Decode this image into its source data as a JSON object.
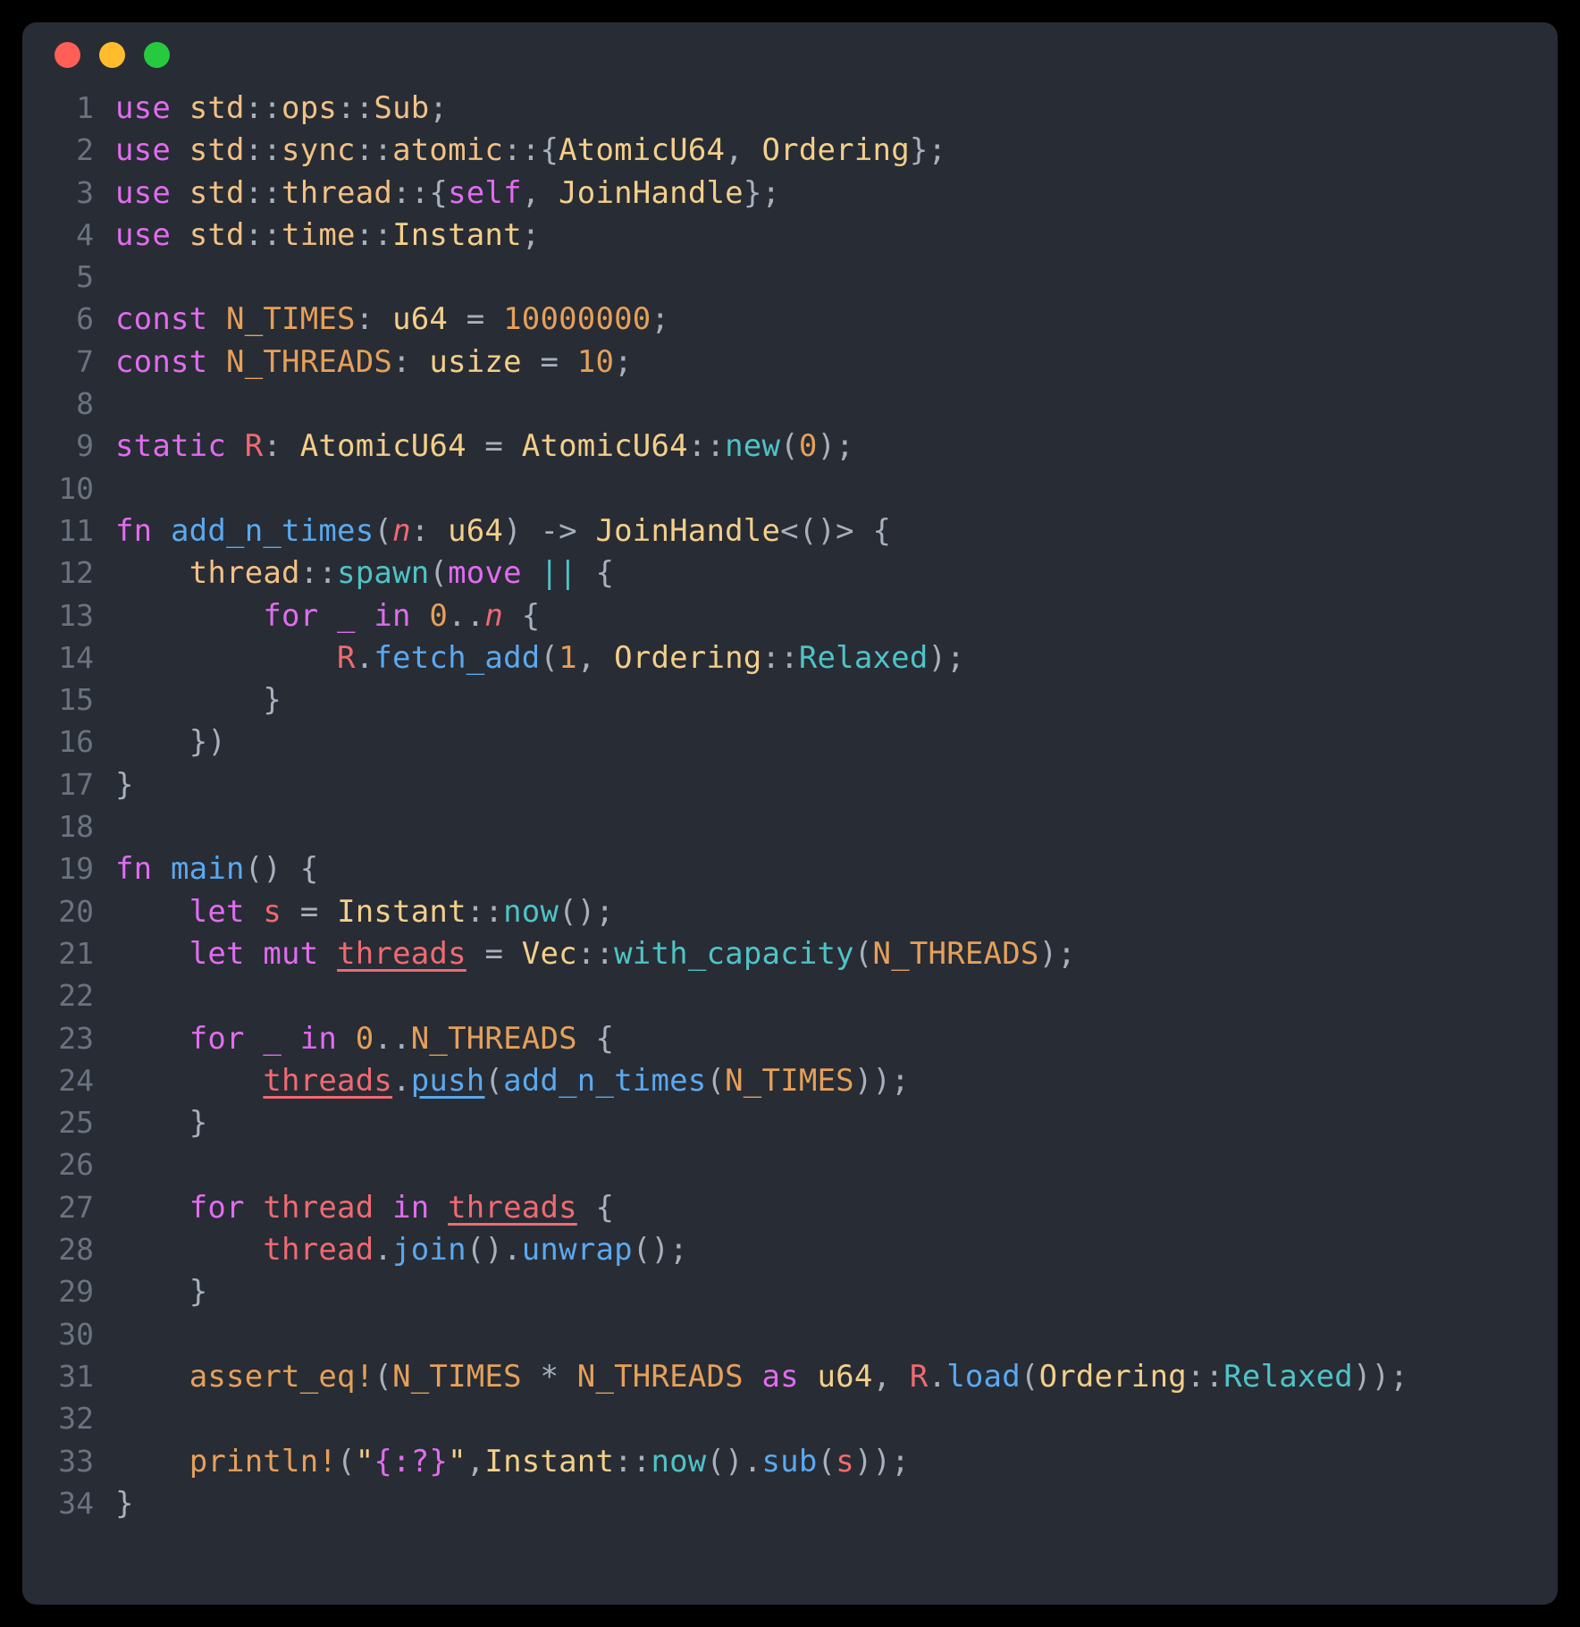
{
  "window": {
    "name": "code-snippet-window",
    "background": "#282c34",
    "page_background": "#000000",
    "traffic_lights": [
      {
        "name": "close",
        "color": "#ff5f56"
      },
      {
        "name": "minimize",
        "color": "#ffbd2e"
      },
      {
        "name": "maximize",
        "color": "#27c93f"
      }
    ]
  },
  "editor": {
    "language": "rust",
    "line_number_color": "#6b7280",
    "first_line": 1,
    "last_line": 34,
    "total_lines": 34,
    "line_numbers": [
      "1",
      "2",
      "3",
      "4",
      "5",
      "6",
      "7",
      "8",
      "9",
      "10",
      "11",
      "12",
      "13",
      "14",
      "15",
      "16",
      "17",
      "18",
      "19",
      "20",
      "21",
      "22",
      "23",
      "24",
      "25",
      "26",
      "27",
      "28",
      "29",
      "30",
      "31",
      "32",
      "33",
      "34"
    ],
    "lines": [
      "use std::ops::Sub;",
      "use std::sync::atomic::{AtomicU64, Ordering};",
      "use std::thread::{self, JoinHandle};",
      "use std::time::Instant;",
      "",
      "const N_TIMES: u64 = 10000000;",
      "const N_THREADS: usize = 10;",
      "",
      "static R: AtomicU64 = AtomicU64::new(0);",
      "",
      "fn add_n_times(n: u64) -> JoinHandle<()> {",
      "    thread::spawn(move || {",
      "        for _ in 0..n {",
      "            R.fetch_add(1, Ordering::Relaxed);",
      "        }",
      "    })",
      "}",
      "",
      "fn main() {",
      "    let s = Instant::now();",
      "    let mut threads = Vec::with_capacity(N_THREADS);",
      "",
      "    for _ in 0..N_THREADS {",
      "        threads.push(add_n_times(N_TIMES));",
      "    }",
      "",
      "    for thread in threads {",
      "        thread.join().unwrap();",
      "    }",
      "",
      "    assert_eq!(N_TIMES * N_THREADS as u64, R.load(Ordering::Relaxed));",
      "",
      "    println!(\"{:?}\",Instant::now().sub(s));",
      "}"
    ],
    "theme_colors": {
      "keyword": "#e06cf0",
      "type": "#f3cf8a",
      "function": "#5aa9f0",
      "associated_function": "#4ec3c7",
      "constant": "#e5a05a",
      "number": "#e5a05a",
      "variable": "#ef6a72",
      "macro": "#e5a05a",
      "string": "#f3cf8a",
      "punctuation": "#a7b0bd"
    }
  }
}
